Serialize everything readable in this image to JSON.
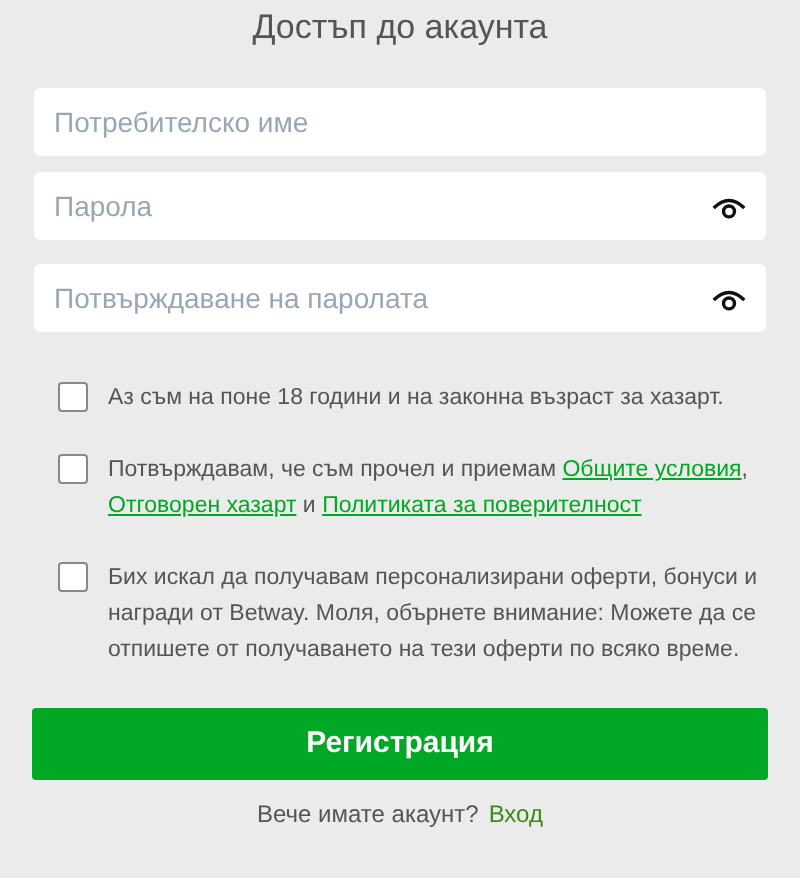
{
  "title": "Достъп до акаунта",
  "fields": [
    {
      "placeholder": "Потребителско име",
      "kind": "text"
    },
    {
      "placeholder": "Парола",
      "kind": "password"
    },
    {
      "placeholder": "Потвърждаване на паролата",
      "kind": "password"
    }
  ],
  "checkboxes": [
    {
      "checked": false,
      "parts": [
        {
          "text": "Аз съм на поне 18 години и на законна възраст за хазарт.",
          "link": false
        }
      ]
    },
    {
      "checked": false,
      "parts": [
        {
          "text": "Потвърждавам, че съм прочел и приемам ",
          "link": false
        },
        {
          "text": "Общите условия",
          "link": true
        },
        {
          "text": ", ",
          "link": false
        },
        {
          "text": "Отговорен хазарт",
          "link": true
        },
        {
          "text": " и ",
          "link": false
        },
        {
          "text": "Политиката за поверителност",
          "link": true
        }
      ]
    },
    {
      "checked": false,
      "parts": [
        {
          "text": "Бих искал да получавам персонализирани оферти, бонуси и награди от Betway. Моля, обърнете внимание: Можете да се отпишете от получаването на тези оферти по всяко време.",
          "link": false
        }
      ]
    }
  ],
  "submit": "Регистрация",
  "footer": {
    "text": "Вече имате акаунт?",
    "link": "Вход"
  }
}
